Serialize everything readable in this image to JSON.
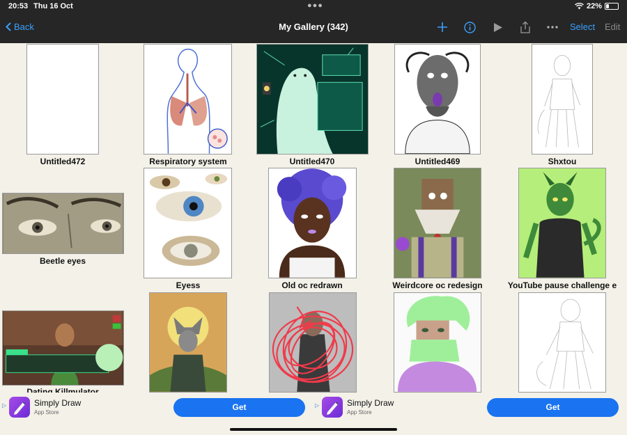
{
  "status": {
    "time": "20:53",
    "date": "Thu 16 Oct",
    "battery": "22%"
  },
  "nav": {
    "back_label": "Back",
    "title": "My Gallery (342)",
    "select_label": "Select",
    "edit_label": "Edit",
    "icons": [
      "plus-icon",
      "info-icon",
      "play-icon",
      "share-icon",
      "more-icon"
    ]
  },
  "gallery": {
    "items": [
      {
        "title": "Untitled472"
      },
      {
        "title": "Respiratory system"
      },
      {
        "title": "Untitled470"
      },
      {
        "title": "Untitled469"
      },
      {
        "title": "Shxtou"
      },
      {
        "title": "Beetle eyes"
      },
      {
        "title": "Eyess"
      },
      {
        "title": "Old oc redrawn"
      },
      {
        "title": "Weirdcore oc redesign"
      },
      {
        "title": "YouTube pause challenge e"
      },
      {
        "title": "Dating Killmulator"
      },
      {
        "title": ""
      },
      {
        "title": ""
      },
      {
        "title": ""
      },
      {
        "title": ""
      }
    ]
  },
  "ads": [
    {
      "name": "Simply Draw",
      "store": "App Store",
      "button": "Get"
    },
    {
      "name": "Simply Draw",
      "store": "App Store",
      "button": "Get"
    }
  ],
  "colors": {
    "accent": "#3aa0ff",
    "nav_bg": "#262626",
    "get_button": "#1a73f0",
    "gallery_bg": "#f3f1e8"
  }
}
